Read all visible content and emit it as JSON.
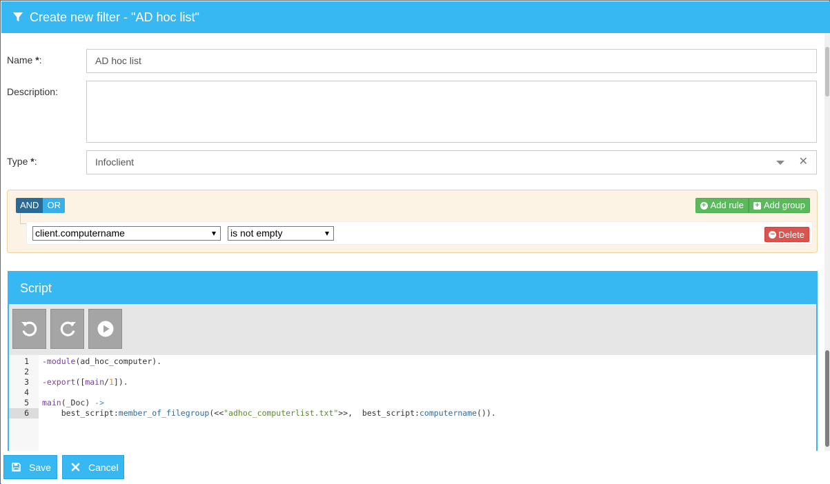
{
  "dialog": {
    "title": "Create new filter - \"AD hoc list\""
  },
  "form": {
    "name_label": "Name",
    "name_required": " *",
    "name_colon": ":",
    "name_value": "AD hoc list",
    "description_label": "Description:",
    "description_value": "",
    "type_label": "Type",
    "type_required": " *",
    "type_colon": ":",
    "type_value": "Infoclient"
  },
  "query_builder": {
    "and_label": "AND",
    "or_label": "OR",
    "add_rule_label": "Add rule",
    "add_group_label": "Add group",
    "rule": {
      "field_value": "client.computername",
      "operator_value": "is not empty",
      "delete_label": "Delete"
    }
  },
  "script": {
    "title": "Script",
    "toolbar": [
      "undo-icon",
      "redo-icon",
      "run-icon"
    ],
    "line_numbers": [
      "1",
      "2",
      "3",
      "4",
      "5",
      "6"
    ],
    "active_line": "6",
    "lines": [
      "-module(ad_hoc_computer).",
      "",
      "-export([main/1]).",
      "",
      "main(_Doc) ->",
      "    best_script:member_of_filegroup(<<\"adhoc_computerlist.txt\">>,  best_script:computername())."
    ]
  },
  "footer": {
    "save_label": "Save",
    "cancel_label": "Cancel"
  },
  "colors": {
    "accent": "#38b8f2",
    "and_active": "#2b6a94",
    "success": "#5cb85c",
    "danger": "#d9534f",
    "query_bg": "#fcf3e4"
  }
}
